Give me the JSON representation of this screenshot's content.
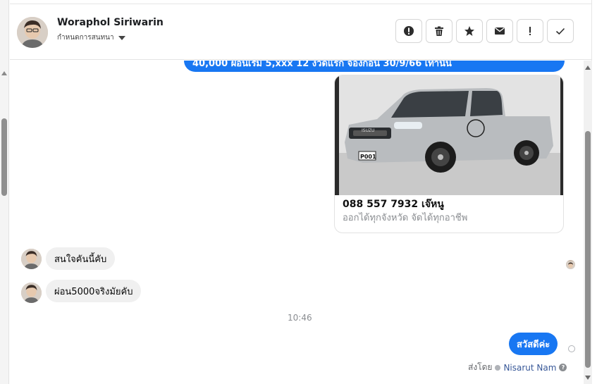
{
  "header": {
    "contact_name": "Woraphol Siriwarin",
    "assign_label": "กำหนดการสนทนา",
    "tools": [
      {
        "icon": "alert-circle-icon",
        "glyph": "⬤!"
      },
      {
        "icon": "trash-icon",
        "glyph": "🗑"
      },
      {
        "icon": "star-icon",
        "glyph": "★"
      },
      {
        "icon": "mail-icon",
        "glyph": "✉"
      },
      {
        "icon": "exclamation-icon",
        "glyph": "!"
      },
      {
        "icon": "check-icon",
        "glyph": "✓"
      }
    ]
  },
  "messages": {
    "banner_text": "40,000 ผ่อนเริ่ม 5,xxx 12 งวดแรก จองก่อน 30/9/66 เท่านั้น",
    "card": {
      "title": "088 557 7932 เจ๊หนู",
      "subtitle": "ออกได้ทุกจังหวัด จัดได้ทุกอาชีพ",
      "plate": "P001",
      "brand": "ISUZU"
    },
    "incoming": [
      {
        "text": "สนใจคันนี้คับ"
      },
      {
        "text": "ผ่อน5000จริงมัยคับ"
      }
    ],
    "timestamp": "10:46",
    "outgoing": {
      "text": "สวัสดีค่ะ"
    },
    "sent_by_label": "ส่งโดย",
    "agent_name": "Nisarut Nam",
    "help_glyph": "?"
  },
  "colors": {
    "accent": "#1877f2",
    "bubble_in": "#f0f0f0"
  }
}
